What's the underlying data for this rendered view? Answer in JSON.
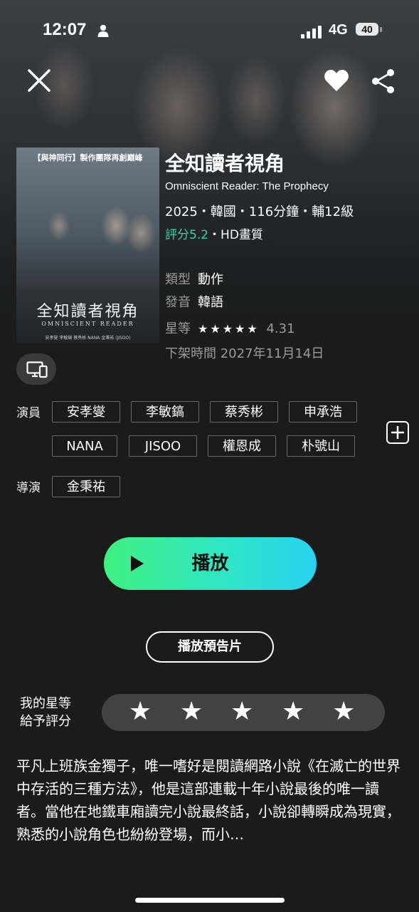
{
  "status_bar": {
    "time": "12:07",
    "network": "4G",
    "battery": "40"
  },
  "poster": {
    "tagline": "【與神同行】製作團隊再創巔峰",
    "title_cn": "全知讀者視角",
    "title_en": "OMNISCIENT READER",
    "credits": "安孝燮 李敏鎬 蔡秀彬 NANA 金秉祐 (JISOO)"
  },
  "movie": {
    "title": "全知讀者視角",
    "subtitle": "Omniscient Reader: The Prophecy",
    "meta": "2025・韓國・116分鐘・輔12級",
    "score": "評分5.2",
    "quality": "・HD畫質",
    "genre_label": "類型",
    "genre": "動作",
    "audio_label": "發音",
    "audio": "韓語",
    "stars_label": "星等",
    "stars_glyphs": "★★★★★",
    "stars_value": "4.31",
    "offline_label": "下架時間",
    "offline_date": "2027年11月14日"
  },
  "cast": {
    "label": "演員",
    "row1": [
      "安孝燮",
      "李敏鎬",
      "蔡秀彬",
      "申承浩"
    ],
    "row2": [
      "NANA",
      "JISOO",
      "權恩成",
      "朴號山"
    ]
  },
  "director": {
    "label": "導演",
    "names": [
      "金秉祐"
    ]
  },
  "actions": {
    "play_label": "播放",
    "trailer_label": "播放預告片"
  },
  "my_rating": {
    "label_line1": "我的星等",
    "label_line2": "給予評分",
    "star": "★"
  },
  "description": "平凡上班族金獨子，唯一嗜好是閱讀網路小說《在滅亡的世界中存活的三種方法》，他是這部連載十年小說最後的唯一讀者。當他在地鐵車廂讀完小說最終話，小說卻轉瞬成為現實，熟悉的小說角色也紛紛登場，而小…",
  "colors": {
    "accent": "#33d6a6",
    "play_gradient_start": "#3ff080",
    "play_gradient_end": "#27d2f0",
    "background": "#1b1b1b"
  },
  "icons": {
    "close": "close-icon",
    "favorite": "heart-icon",
    "share": "share-icon",
    "device": "devices-icon",
    "more": "plus-icon",
    "play": "play-icon"
  }
}
